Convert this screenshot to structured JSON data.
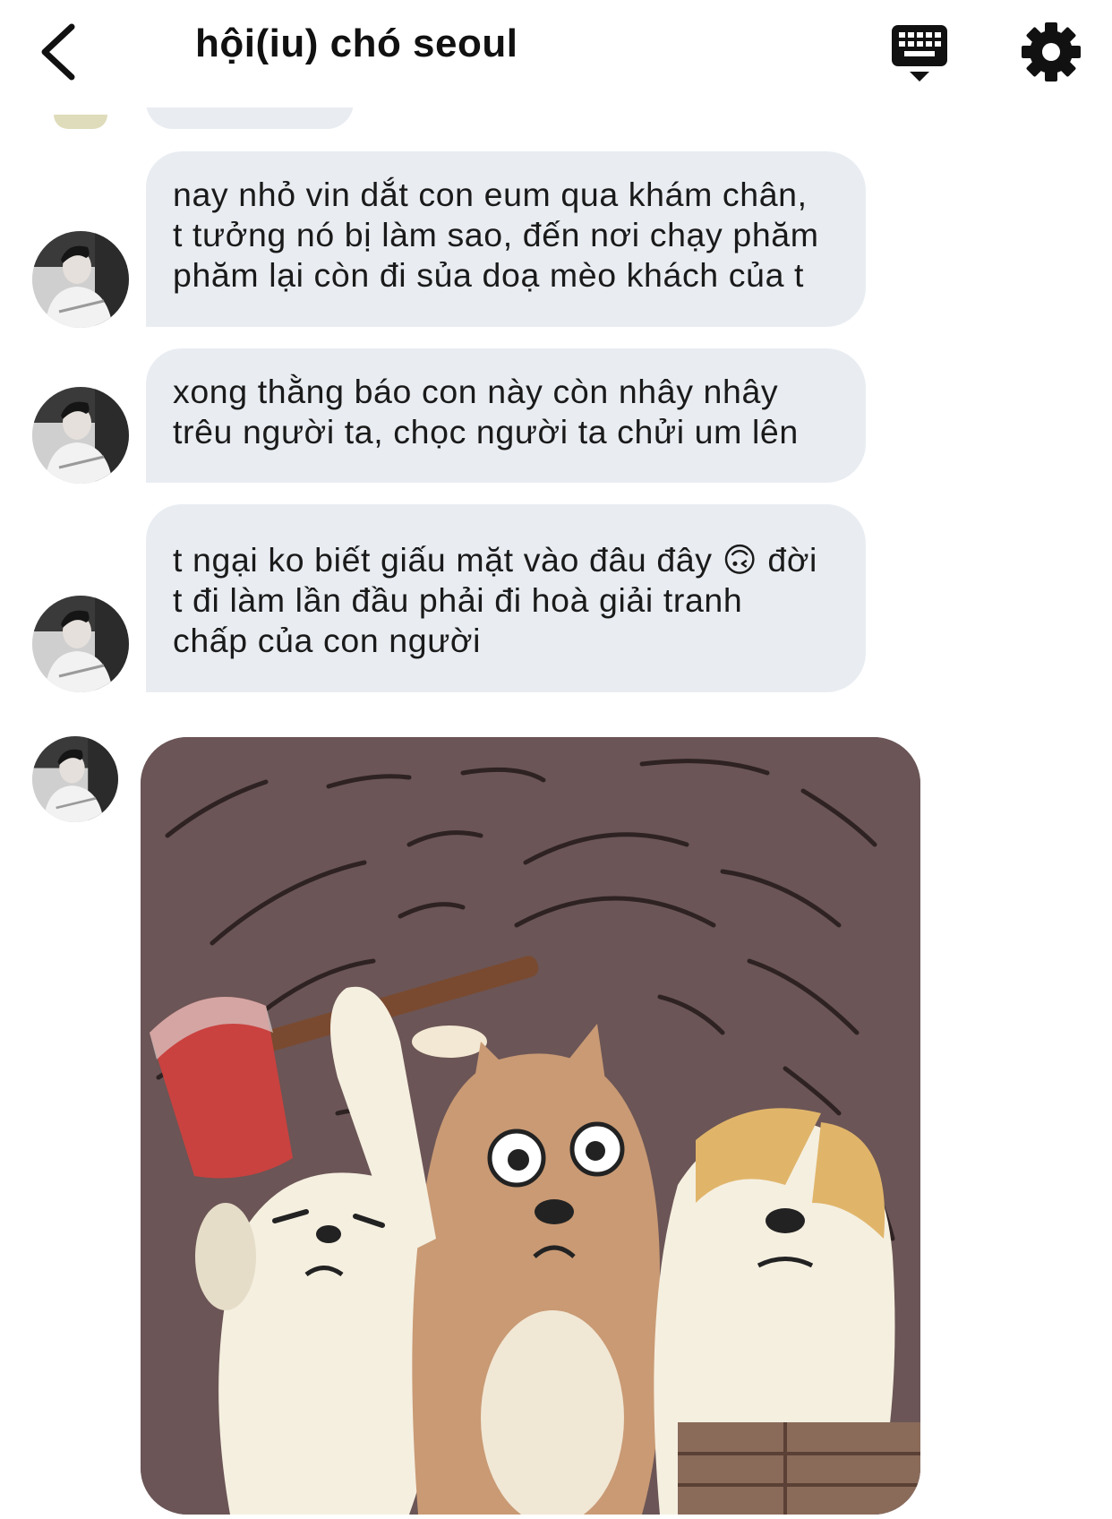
{
  "header": {
    "title": "hội(iu) chó seoul",
    "back_icon": "chevron-left-icon",
    "keyboard_icon": "keyboard-icon",
    "settings_icon": "gear-icon"
  },
  "messages": [
    {
      "text": "nay nhỏ vin dắt con eum qua khám chân,\nt tưởng nó bị làm sao, đến nơi chạy phăm\nphăm lại còn đi sủa doạ mèo khách của t"
    },
    {
      "text": "xong thằng báo con này còn nhây nhây\ntrêu người ta, chọc người ta chửi um lên"
    },
    {
      "text_before_emoji": "t ngại ko biết giấu mặt vào đâu đây ",
      "emoji": "🙃",
      "text_after_emoji": " đời\nt đi làm lần đầu phải đi hoà giải tranh\nchấp của con người"
    }
  ],
  "sticker": {
    "description_icon": "cartoon-dogs-axe-sticker"
  },
  "colors": {
    "bubble_bg": "#e9edf2",
    "text": "#1a1a1a",
    "sticker_bg": "#6b5556"
  }
}
